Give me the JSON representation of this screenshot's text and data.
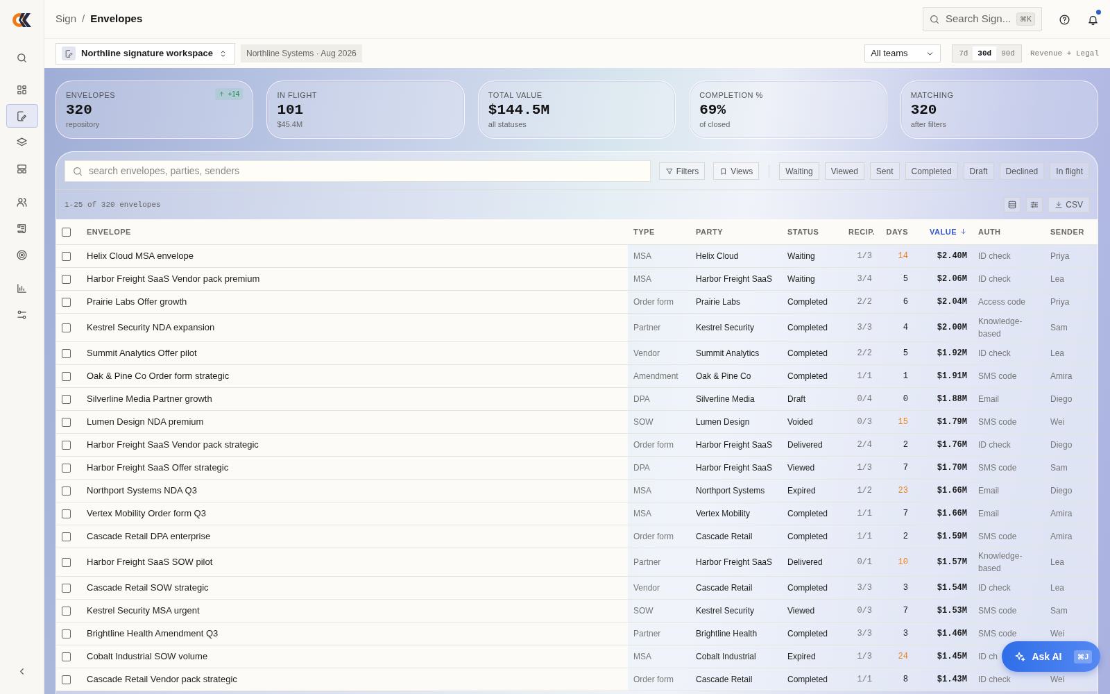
{
  "sidebar": {
    "items": [
      {
        "selected": false
      },
      {
        "selected": false
      },
      {
        "selected": true
      },
      {
        "selected": false
      },
      {
        "selected": false
      },
      {
        "selected": false
      },
      {
        "selected": false
      },
      {
        "selected": false
      },
      {
        "selected": false
      },
      {
        "selected": false
      }
    ]
  },
  "breadcrumb_separator": "/",
  "breadcrumb": [
    {
      "label": "Sign",
      "current": false
    },
    {
      "label": "Envelopes",
      "current": true
    }
  ],
  "global_search": {
    "placeholder": "Search Sign...",
    "shortcut": "⌘K"
  },
  "notifications": {
    "unread": true
  },
  "workspace": {
    "name": "Northline signature workspace",
    "meta": "Northline Systems · Aug 2026"
  },
  "team_select": {
    "value": "All teams"
  },
  "ranges": [
    {
      "label": "7d",
      "selected": false
    },
    {
      "label": "30d",
      "selected": true
    },
    {
      "label": "90d",
      "selected": false
    }
  ],
  "scope": "Revenue + Legal",
  "kpis": [
    {
      "label": "ENVELOPES",
      "value": "320",
      "caption": "repository",
      "delta": "+14"
    },
    {
      "label": "IN FLIGHT",
      "value": "101",
      "caption": "$45.4M"
    },
    {
      "label": "TOTAL VALUE",
      "value": "$144.5M",
      "caption": "all statuses"
    },
    {
      "label": "COMPLETION %",
      "value": "69%",
      "caption": "of closed"
    },
    {
      "label": "MATCHING",
      "value": "320",
      "caption": "after filters"
    }
  ],
  "toolbar": {
    "search_placeholder": "search envelopes, parties, senders",
    "buttons": [
      "Filters",
      "Views"
    ],
    "status_chips": [
      "Waiting",
      "Viewed",
      "Sent",
      "Completed",
      "Draft",
      "Declined",
      "In flight"
    ],
    "count": "1-25 of 320 envelopes",
    "export": "CSV"
  },
  "table": {
    "select_all": {
      "checked": false
    },
    "columns": [
      {
        "label": "ENVELOPE",
        "sorted": false
      },
      {
        "label": "TYPE",
        "sorted": false
      },
      {
        "label": "PARTY",
        "sorted": false
      },
      {
        "label": "STATUS",
        "sorted": false
      },
      {
        "label": "RECIP.",
        "sorted": false
      },
      {
        "label": "DAYS",
        "sorted": false
      },
      {
        "label": "VALUE",
        "sorted": true
      },
      {
        "label": "AUTH",
        "sorted": false
      },
      {
        "label": "SENDER",
        "sorted": false
      }
    ],
    "rows": [
      {
        "checked": false,
        "envelope": "Helix Cloud MSA envelope",
        "type": "MSA",
        "party": "Helix Cloud",
        "status": "Waiting",
        "recip": "1/3",
        "days": "14",
        "days_flag": true,
        "value": "$2.40M",
        "auth": "ID check",
        "sender": "Priya"
      },
      {
        "checked": false,
        "envelope": "Harbor Freight SaaS Vendor pack premium",
        "type": "MSA",
        "party": "Harbor Freight SaaS",
        "status": "Waiting",
        "recip": "3/4",
        "days": "5",
        "days_flag": false,
        "value": "$2.06M",
        "auth": "ID check",
        "sender": "Lea"
      },
      {
        "checked": false,
        "envelope": "Prairie Labs Offer growth",
        "type": "Order form",
        "party": "Prairie Labs",
        "status": "Completed",
        "recip": "2/2",
        "days": "6",
        "days_flag": false,
        "value": "$2.04M",
        "auth": "Access code",
        "sender": "Priya"
      },
      {
        "checked": false,
        "envelope": "Kestrel Security NDA expansion",
        "type": "Partner",
        "party": "Kestrel Security",
        "status": "Completed",
        "recip": "3/3",
        "days": "4",
        "days_flag": false,
        "value": "$2.00M",
        "auth": "Knowledge-based",
        "sender": "Sam"
      },
      {
        "checked": false,
        "envelope": "Summit Analytics Offer pilot",
        "type": "Vendor",
        "party": "Summit Analytics",
        "status": "Completed",
        "recip": "2/2",
        "days": "5",
        "days_flag": false,
        "value": "$1.92M",
        "auth": "ID check",
        "sender": "Lea"
      },
      {
        "checked": false,
        "envelope": "Oak & Pine Co Order form strategic",
        "type": "Amendment",
        "party": "Oak & Pine Co",
        "status": "Completed",
        "recip": "1/1",
        "days": "1",
        "days_flag": false,
        "value": "$1.91M",
        "auth": "SMS code",
        "sender": "Amira"
      },
      {
        "checked": false,
        "envelope": "Silverline Media Partner growth",
        "type": "DPA",
        "party": "Silverline Media",
        "status": "Draft",
        "recip": "0/4",
        "days": "0",
        "days_flag": false,
        "value": "$1.88M",
        "auth": "Email",
        "sender": "Diego"
      },
      {
        "checked": false,
        "envelope": "Lumen Design NDA premium",
        "type": "SOW",
        "party": "Lumen Design",
        "status": "Voided",
        "recip": "0/3",
        "days": "15",
        "days_flag": true,
        "value": "$1.79M",
        "auth": "SMS code",
        "sender": "Wei"
      },
      {
        "checked": false,
        "envelope": "Harbor Freight SaaS Vendor pack strategic",
        "type": "Order form",
        "party": "Harbor Freight SaaS",
        "status": "Delivered",
        "recip": "2/4",
        "days": "2",
        "days_flag": false,
        "value": "$1.76M",
        "auth": "ID check",
        "sender": "Diego"
      },
      {
        "checked": false,
        "envelope": "Harbor Freight SaaS Offer strategic",
        "type": "DPA",
        "party": "Harbor Freight SaaS",
        "status": "Viewed",
        "recip": "1/3",
        "days": "7",
        "days_flag": false,
        "value": "$1.70M",
        "auth": "SMS code",
        "sender": "Sam"
      },
      {
        "checked": false,
        "envelope": "Northport Systems NDA Q3",
        "type": "MSA",
        "party": "Northport Systems",
        "status": "Expired",
        "recip": "1/2",
        "days": "23",
        "days_flag": true,
        "value": "$1.66M",
        "auth": "Email",
        "sender": "Diego"
      },
      {
        "checked": false,
        "envelope": "Vertex Mobility Order form Q3",
        "type": "MSA",
        "party": "Vertex Mobility",
        "status": "Completed",
        "recip": "1/1",
        "days": "7",
        "days_flag": false,
        "value": "$1.66M",
        "auth": "Email",
        "sender": "Amira"
      },
      {
        "checked": false,
        "envelope": "Cascade Retail DPA enterprise",
        "type": "Order form",
        "party": "Cascade Retail",
        "status": "Completed",
        "recip": "1/1",
        "days": "2",
        "days_flag": false,
        "value": "$1.59M",
        "auth": "SMS code",
        "sender": "Amira"
      },
      {
        "checked": false,
        "envelope": "Harbor Freight SaaS SOW pilot",
        "type": "Partner",
        "party": "Harbor Freight SaaS",
        "status": "Delivered",
        "recip": "0/1",
        "days": "10",
        "days_flag": true,
        "value": "$1.57M",
        "auth": "Knowledge-based",
        "sender": "Lea"
      },
      {
        "checked": false,
        "envelope": "Cascade Retail SOW strategic",
        "type": "Vendor",
        "party": "Cascade Retail",
        "status": "Completed",
        "recip": "3/3",
        "days": "3",
        "days_flag": false,
        "value": "$1.54M",
        "auth": "ID check",
        "sender": "Lea"
      },
      {
        "checked": false,
        "envelope": "Kestrel Security MSA urgent",
        "type": "SOW",
        "party": "Kestrel Security",
        "status": "Viewed",
        "recip": "0/3",
        "days": "7",
        "days_flag": false,
        "value": "$1.53M",
        "auth": "SMS code",
        "sender": "Sam"
      },
      {
        "checked": false,
        "envelope": "Brightline Health Amendment Q3",
        "type": "Partner",
        "party": "Brightline Health",
        "status": "Completed",
        "recip": "3/3",
        "days": "3",
        "days_flag": false,
        "value": "$1.46M",
        "auth": "SMS code",
        "sender": "Wei"
      },
      {
        "checked": false,
        "envelope": "Cobalt Industrial SOW volume",
        "type": "MSA",
        "party": "Cobalt Industrial",
        "status": "Expired",
        "recip": "1/3",
        "days": "24",
        "days_flag": true,
        "value": "$1.45M",
        "auth": "ID ch"
      },
      {
        "checked": false,
        "envelope": "Cascade Retail Vendor pack strategic",
        "type": "Order form",
        "party": "Cascade Retail",
        "status": "Completed",
        "recip": "1/1",
        "days": "8",
        "days_flag": false,
        "value": "$1.43M",
        "auth": "ID check",
        "sender": "Wei"
      }
    ]
  },
  "ask_ai": {
    "label": "Ask AI",
    "shortcut": "⌘J"
  }
}
